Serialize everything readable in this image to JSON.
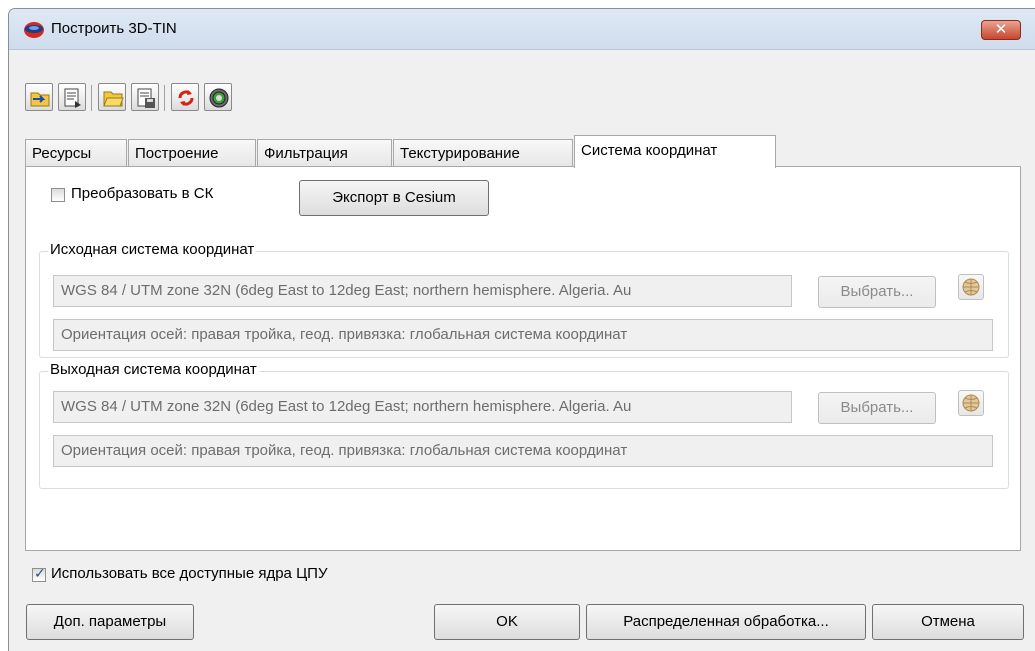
{
  "window": {
    "title": "Построить 3D-TIN",
    "close_glyph": "✕"
  },
  "toolbar": {
    "buttons": [
      {
        "icon": "open-folder-arrow-icon"
      },
      {
        "icon": "export-document-icon"
      },
      {
        "icon": "open-folder-icon"
      },
      {
        "icon": "save-document-icon"
      },
      {
        "icon": "refresh-icon"
      },
      {
        "icon": "settings-gear-icon"
      }
    ]
  },
  "tabs": [
    {
      "label": "Ресурсы"
    },
    {
      "label": "Построение"
    },
    {
      "label": "Фильтрация"
    },
    {
      "label": "Текстурирование"
    },
    {
      "label": "Система координат",
      "active": true
    }
  ],
  "coords": {
    "convert_checkbox": {
      "label": "Преобразовать в СК",
      "checked": false
    },
    "export_button": "Экспорт в Cesium",
    "source": {
      "title": "Исходная система координат",
      "crs": "WGS 84 / UTM zone 32N (6deg East to 12deg East; northern hemisphere. Algeria. Au",
      "select_button": "Выбрать...",
      "orientation": "Ориентация осей: правая тройка, геод. привязка: глобальная система координат"
    },
    "output": {
      "title": "Выходная система координат",
      "crs": "WGS 84 / UTM zone 32N (6deg East to 12deg East; northern hemisphere. Algeria. Au",
      "select_button": "Выбрать...",
      "orientation": "Ориентация осей: правая тройка, геод. привязка: глобальная система координат"
    }
  },
  "footer": {
    "use_all_cores": {
      "label": "Использовать все доступные ядра ЦПУ",
      "checked": true
    },
    "extra_params_button": "Доп. параметры",
    "ok_button": "OK",
    "distributed_button": "Распределенная обработка...",
    "cancel_button": "Отмена"
  }
}
